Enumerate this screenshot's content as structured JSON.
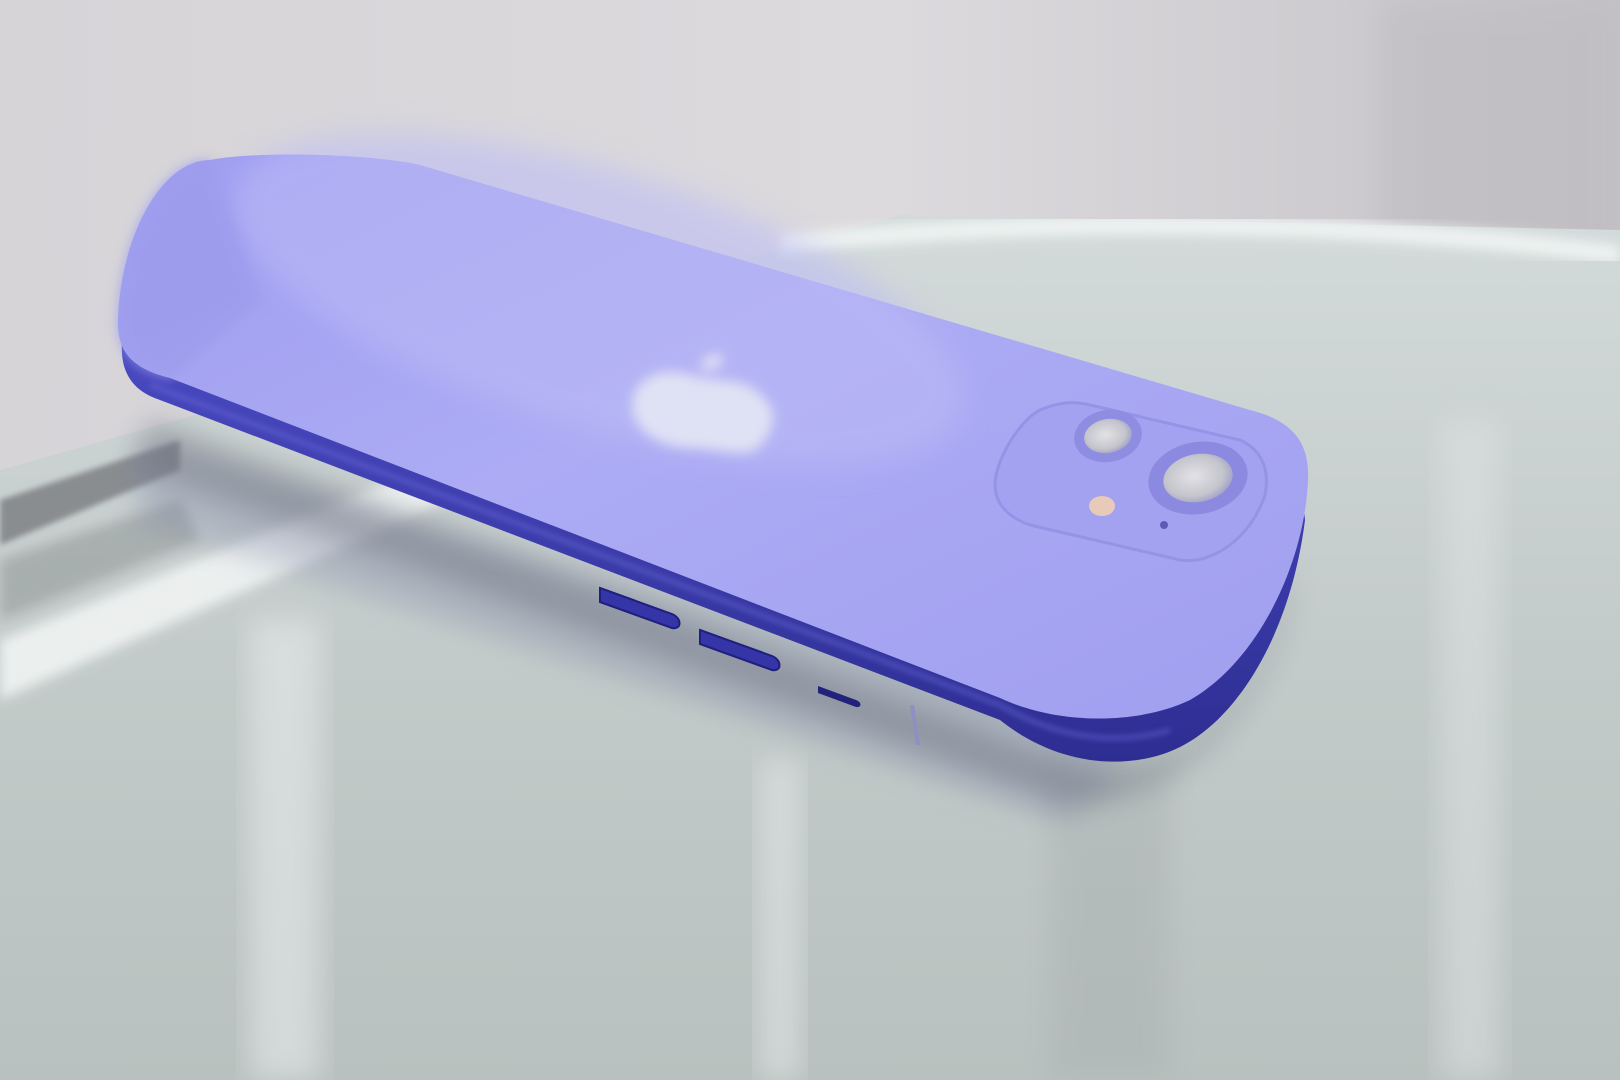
{
  "scene": {
    "colors": {
      "wall_light": "#d9d7da",
      "wall_shadow": "#b9b7bb",
      "glass_light": "#e7ecec",
      "glass_mid": "#c8d0d0",
      "glass_dark": "#9ea6a6",
      "glass_edge_highlight": "#f4f8f7",
      "metal_rail": "#7a7d80",
      "phone_back": "#a7a6f1",
      "phone_back_light": "#b9b8f6",
      "phone_back_shadow": "#8f8ee6",
      "phone_frame": "#3f3fb8",
      "phone_frame_dark": "#28288a",
      "camera_bump": "#a2a1ef",
      "lens_ring": "#8d8ce2",
      "lens_glass": "#cfcfd6",
      "flash": "#e9c9b8",
      "logo": "#e1e4f3"
    },
    "icons": [
      "apple-logo-icon"
    ]
  }
}
